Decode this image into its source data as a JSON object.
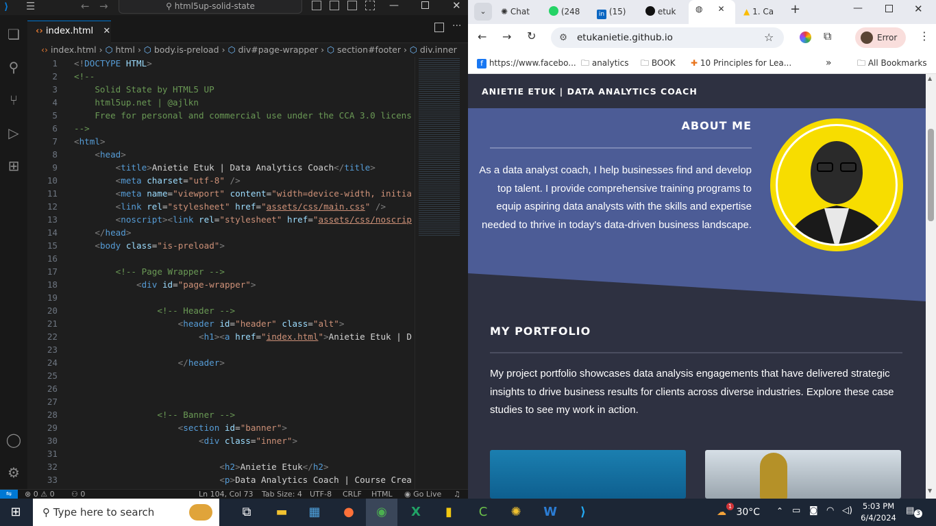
{
  "vscode": {
    "command_center": "html5up-solid-state",
    "tab": {
      "label": "index.html"
    },
    "breadcrumb": [
      "index.html",
      "html",
      "body.is-preload",
      "div#page-wrapper",
      "section#footer",
      "div.inner"
    ],
    "lines": [
      {
        "n": "1",
        "html": "<span class='c-br'>&lt;!</span><span class='c-tag'>DOCTYPE</span> <span class='c-attr'>HTML</span><span class='c-br'>&gt;</span>"
      },
      {
        "n": "2",
        "html": "<span class='c-com'>&lt;!--</span>"
      },
      {
        "n": "3",
        "html": "<span class='c-com'>    Solid State by HTML5 UP</span>"
      },
      {
        "n": "4",
        "html": "<span class='c-com'>    html5up.net | @ajlkn</span>"
      },
      {
        "n": "5",
        "html": "<span class='c-com'>    Free for personal and commercial use under the CCA 3.0 licens</span>"
      },
      {
        "n": "6",
        "html": "<span class='c-com'>--&gt;</span>"
      },
      {
        "n": "7",
        "html": "<span class='c-br'>&lt;</span><span class='c-tag'>html</span><span class='c-br'>&gt;</span>"
      },
      {
        "n": "8",
        "html": "    <span class='c-br'>&lt;</span><span class='c-tag'>head</span><span class='c-br'>&gt;</span>"
      },
      {
        "n": "9",
        "html": "        <span class='c-br'>&lt;</span><span class='c-tag'>title</span><span class='c-br'>&gt;</span>Anietie Etuk | Data Analytics Coach<span class='c-br'>&lt;/</span><span class='c-tag'>title</span><span class='c-br'>&gt;</span>"
      },
      {
        "n": "10",
        "html": "        <span class='c-br'>&lt;</span><span class='c-tag'>meta</span> <span class='c-attr'>charset</span>=<span class='c-str'>\"utf-8\"</span> <span class='c-br'>/&gt;</span>"
      },
      {
        "n": "11",
        "html": "        <span class='c-br'>&lt;</span><span class='c-tag'>meta</span> <span class='c-attr'>name</span>=<span class='c-str'>\"viewport\"</span> <span class='c-attr'>content</span>=<span class='c-str'>\"width=device-width, initia</span>"
      },
      {
        "n": "12",
        "html": "        <span class='c-br'>&lt;</span><span class='c-tag'>link</span> <span class='c-attr'>rel</span>=<span class='c-str'>\"stylesheet\"</span> <span class='c-attr'>href</span>=<span class='c-str'>\"<u>assets/css/main.css</u>\"</span> <span class='c-br'>/&gt;</span>"
      },
      {
        "n": "13",
        "html": "        <span class='c-br'>&lt;</span><span class='c-tag'>noscript</span><span class='c-br'>&gt;&lt;</span><span class='c-tag'>link</span> <span class='c-attr'>rel</span>=<span class='c-str'>\"stylesheet\"</span> <span class='c-attr'>href</span>=<span class='c-str'>\"<u>assets/css/noscrip</u></span>"
      },
      {
        "n": "14",
        "html": "    <span class='c-br'>&lt;/</span><span class='c-tag'>head</span><span class='c-br'>&gt;</span>"
      },
      {
        "n": "15",
        "html": "    <span class='c-br'>&lt;</span><span class='c-tag'>body</span> <span class='c-attr'>class</span>=<span class='c-str'>\"is-preload\"</span><span class='c-br'>&gt;</span>"
      },
      {
        "n": "16",
        "html": ""
      },
      {
        "n": "17",
        "html": "        <span class='c-com'>&lt;!-- Page Wrapper --&gt;</span>"
      },
      {
        "n": "18",
        "html": "            <span class='c-br'>&lt;</span><span class='c-tag'>div</span> <span class='c-attr'>id</span>=<span class='c-str'>\"page-wrapper\"</span><span class='c-br'>&gt;</span>"
      },
      {
        "n": "19",
        "html": ""
      },
      {
        "n": "20",
        "html": "                <span class='c-com'>&lt;!-- Header --&gt;</span>"
      },
      {
        "n": "21",
        "html": "                    <span class='c-br'>&lt;</span><span class='c-tag'>header</span> <span class='c-attr'>id</span>=<span class='c-str'>\"header\"</span> <span class='c-attr'>class</span>=<span class='c-str'>\"alt\"</span><span class='c-br'>&gt;</span>"
      },
      {
        "n": "22",
        "html": "                        <span class='c-br'>&lt;</span><span class='c-tag'>h1</span><span class='c-br'>&gt;&lt;</span><span class='c-tag'>a</span> <span class='c-attr'>href</span>=<span class='c-str'>\"<u>index.html</u>\"</span><span class='c-br'>&gt;</span>Anietie Etuk | D"
      },
      {
        "n": "23",
        "html": ""
      },
      {
        "n": "24",
        "html": "                    <span class='c-br'>&lt;/</span><span class='c-tag'>header</span><span class='c-br'>&gt;</span>"
      },
      {
        "n": "25",
        "html": ""
      },
      {
        "n": "26",
        "html": ""
      },
      {
        "n": "27",
        "html": ""
      },
      {
        "n": "28",
        "html": "                <span class='c-com'>&lt;!-- Banner --&gt;</span>"
      },
      {
        "n": "29",
        "html": "                    <span class='c-br'>&lt;</span><span class='c-tag'>section</span> <span class='c-attr'>id</span>=<span class='c-str'>\"banner\"</span><span class='c-br'>&gt;</span>"
      },
      {
        "n": "30",
        "html": "                        <span class='c-br'>&lt;</span><span class='c-tag'>div</span> <span class='c-attr'>class</span>=<span class='c-str'>\"inner\"</span><span class='c-br'>&gt;</span>"
      },
      {
        "n": "31",
        "html": ""
      },
      {
        "n": "32",
        "html": "                            <span class='c-br'>&lt;</span><span class='c-tag'>h2</span><span class='c-br'>&gt;</span>Anietie Etuk<span class='c-br'>&lt;/</span><span class='c-tag'>h2</span><span class='c-br'>&gt;</span>"
      },
      {
        "n": "33",
        "html": "                            <span class='c-br'>&lt;</span><span class='c-tag'>p</span><span class='c-br'>&gt;</span>Data Analytics Coach | Course Crea"
      }
    ],
    "status": {
      "errors": "0",
      "warnings": "0",
      "ports": "0",
      "position": "Ln 104, Col 73",
      "tabsize": "Tab Size: 4",
      "encoding": "UTF-8",
      "eol": "CRLF",
      "lang": "HTML",
      "golive": "Go Live"
    }
  },
  "chrome": {
    "tabs": [
      {
        "label": "Chat"
      },
      {
        "label": "(248"
      },
      {
        "label": "(15)"
      },
      {
        "label": "etuk"
      },
      {
        "label": ""
      },
      {
        "label": "1. Ca"
      }
    ],
    "url": "etukanietie.github.io",
    "profile": "Error",
    "bookmarks": [
      "https://www.facebo...",
      "analytics",
      "BOOK",
      "10 Principles for Lea...",
      "All Bookmarks"
    ],
    "page": {
      "site_title": "ANIETIE ETUK | DATA ANALYTICS COACH",
      "about_heading": "ABOUT ME",
      "about_lines": [
        "As a data analyst coach, I help businesses find and develop",
        "top talent. I provide comprehensive training programs to",
        "equip aspiring data analysts with the skills and expertise",
        "needed to thrive in today's data-driven business landscape."
      ],
      "portfolio_heading": "MY PORTFOLIO",
      "portfolio_lines": [
        "My project portfolio showcases data analysis engagements that have delivered strategic",
        "insights to drive business results for clients across diverse industries. Explore these case",
        "studies to see my work in action."
      ]
    }
  },
  "taskbar": {
    "search_placeholder": "Type here to search",
    "weather": "30°C",
    "weather_badge": "1",
    "time": "5:03 PM",
    "date": "6/4/2024",
    "notifications": "3"
  },
  "colors": {
    "accent": "#0078d4",
    "about_bg": "#4c5c96",
    "page_bg": "#2e3141",
    "photo_ring": "#f7dd00"
  }
}
